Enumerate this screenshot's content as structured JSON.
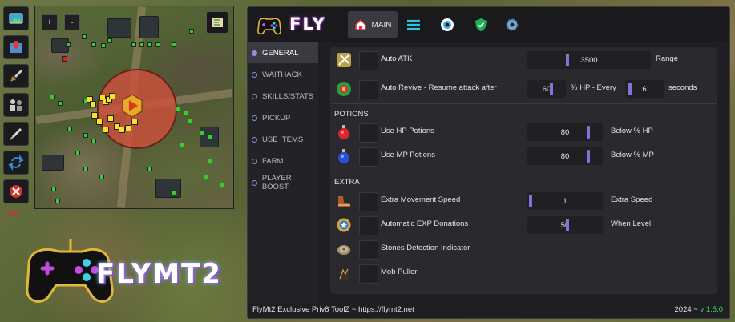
{
  "left_toolbar": {
    "counter": "<14>",
    "buttons": [
      {
        "name": "screenshot-icon"
      },
      {
        "name": "map-pin-icon"
      },
      {
        "name": "sword-icon"
      },
      {
        "name": "crowd-icon"
      },
      {
        "name": "syringe-icon"
      },
      {
        "name": "refresh-icon"
      },
      {
        "name": "close-icon"
      }
    ]
  },
  "minimap": {
    "zoom_in": "+",
    "zoom_out": "-"
  },
  "logo": {
    "text": "FLYMT2"
  },
  "app": {
    "title": "FLY",
    "tabs": [
      {
        "label": "MAIN",
        "icon": "home-icon",
        "active": true
      },
      {
        "label": "",
        "icon": "menu-lines-icon"
      },
      {
        "label": "",
        "icon": "eye-icon"
      },
      {
        "label": "",
        "icon": "shield-check-icon"
      },
      {
        "label": "",
        "icon": "gear-icon"
      }
    ],
    "sidebar": [
      {
        "label": "GENERAL",
        "active": true
      },
      {
        "label": "WAITHACK"
      },
      {
        "label": "SKILLS/STATS"
      },
      {
        "label": "PICKUP"
      },
      {
        "label": "USE ITEMS"
      },
      {
        "label": "FARM"
      },
      {
        "label": "PLAYER BOOST"
      }
    ],
    "general": {
      "auto_atk": {
        "label": "Auto ATK",
        "value": "3500",
        "suffix": "Range"
      },
      "auto_revive": {
        "label": "Auto Revive - Resume attack after",
        "hp_value": "60",
        "hp_suffix": "% HP - Every",
        "seconds_value": "6",
        "seconds_suffix": "seconds"
      },
      "potions_title": "POTIONS",
      "hp_potions": {
        "label": "Use HP Potions",
        "value": "80",
        "suffix": "Below % HP"
      },
      "mp_potions": {
        "label": "Use MP Potions",
        "value": "80",
        "suffix": "Below % MP"
      },
      "extra_title": "EXTRA",
      "move_speed": {
        "label": "Extra Movement Speed",
        "value": "1",
        "suffix": "Extra Speed"
      },
      "exp_donation": {
        "label": "Automatic EXP Donations",
        "value": "50",
        "suffix": "When Level"
      },
      "stones": {
        "label": "Stones Detection Indicator"
      },
      "mob_puller": {
        "label": "Mob Puller"
      }
    },
    "footer": {
      "left": "FlyMt2 Exclusive Priv8 ToolZ ~ https://flymt2.net",
      "year": "2024 ~",
      "version": "v 1.5.0"
    }
  }
}
